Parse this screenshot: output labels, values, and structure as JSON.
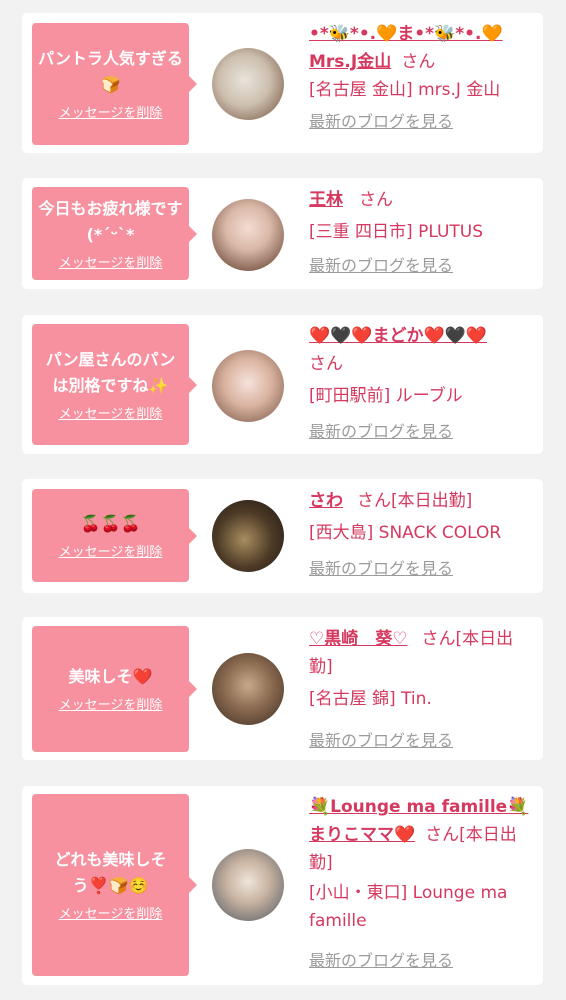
{
  "delete_label": "メッセージを削除",
  "blog_link_label": "最新のブログを見る",
  "san_suffix": "さん",
  "items": [
    {
      "message": "パントラ人気すぎる🍞",
      "name": "•*🐝*•.🧡ま•*🐝*•.🧡 Mrs.J金山",
      "suffix": "さん",
      "shop": "[名古屋 金山] mrs.J 金山"
    },
    {
      "message": "今日もお疲れ様です(*ˊᵕˋ*",
      "name": "王林",
      "suffix": "さん",
      "shop": "[三重 四日市] PLUTUS"
    },
    {
      "message": "パン屋さんのパンは別格ですね✨",
      "name": "❤️🖤❤️まどか❤️🖤❤️",
      "suffix": "さん",
      "shop": "[町田駅前] ルーブル"
    },
    {
      "message": "🍒🍒🍒",
      "name": "さわ",
      "suffix": "さん[本日出勤]",
      "shop": "[西大島] SNACK COLOR"
    },
    {
      "message": "美味しそ❤️",
      "name": "♡黒崎　葵♡",
      "suffix": "さん[本日出勤]",
      "shop": "[名古屋 錦] Tin."
    },
    {
      "message": "どれも美味しそう❣️🍞☺️",
      "name": "💐Lounge ma famille💐まりこママ❤️",
      "suffix": "さん[本日出勤]",
      "shop": "[小山・東口] Lounge ma famille"
    }
  ],
  "colors": {
    "bubble": "#f7909f",
    "accent": "#d6395f",
    "link_gray": "#9b9b9b",
    "background": "#f2f2f2"
  }
}
